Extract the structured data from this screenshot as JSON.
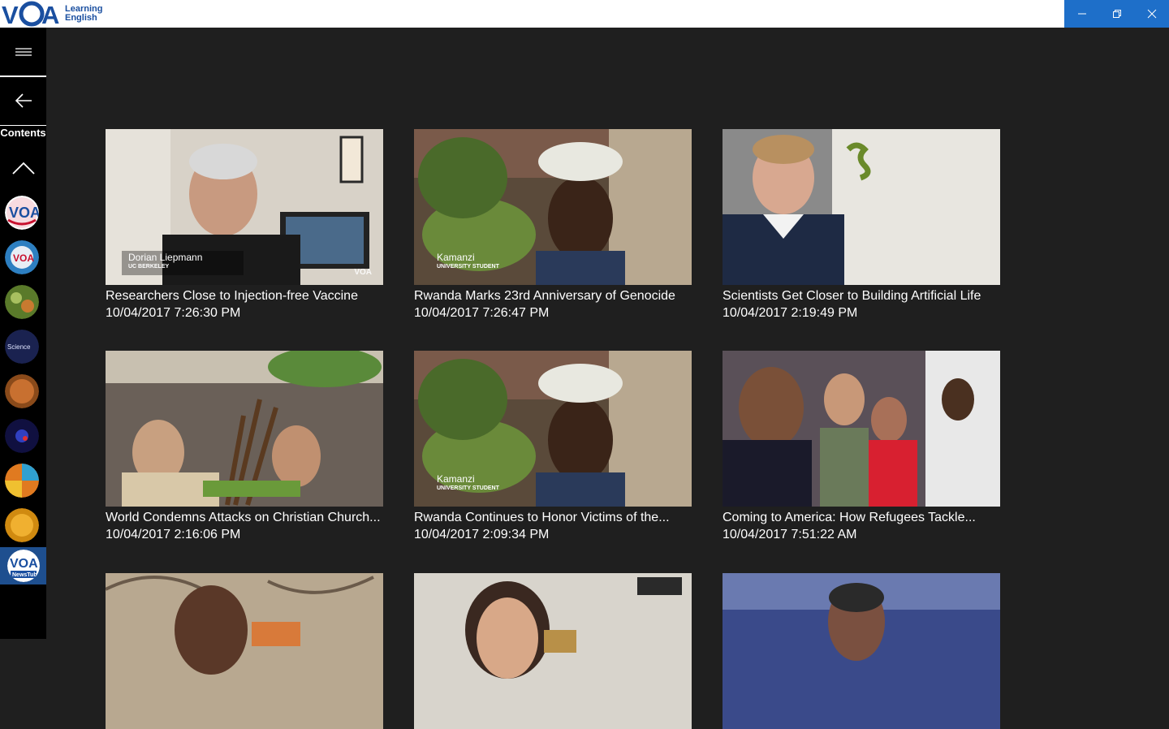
{
  "app": {
    "logo_text_line1": "Learning",
    "logo_text_line2": "English",
    "brand_color": "#1a4fa0",
    "titlebar_accent": "#1e6fc9"
  },
  "window_controls": [
    "minimize-icon",
    "restore-icon",
    "close-icon"
  ],
  "sidebar": {
    "menu_icon": "hamburger-icon",
    "back_icon": "arrow-left-icon",
    "contents_label": "Contents",
    "collapse_icon": "chevron-up-icon",
    "channels": [
      {
        "name": "channel-voa",
        "color": "#c8102e",
        "selected": false
      },
      {
        "name": "channel-voa-globe",
        "color": "#2d7fc1",
        "selected": false
      },
      {
        "name": "channel-nature",
        "color": "#5a7a2a",
        "selected": false
      },
      {
        "name": "channel-science",
        "color": "#1a2250",
        "selected": false
      },
      {
        "name": "channel-planet",
        "color": "#8a4a1a",
        "selected": false
      },
      {
        "name": "channel-space",
        "color": "#1a1a6a",
        "selected": false
      },
      {
        "name": "channel-colorful",
        "color": "#e07a20",
        "selected": false
      },
      {
        "name": "channel-orange",
        "color": "#d08a10",
        "selected": false
      },
      {
        "name": "channel-newstube",
        "color": "#1e4f8f",
        "selected": true
      }
    ]
  },
  "articles": [
    {
      "title": "Researchers Close to Injection-free Vaccine",
      "date": "10/04/2017 7:26:30 PM",
      "caption_name": "Dorian Liepmann",
      "caption_sub": "UC BERKELEY",
      "thumb": "#5a4a3e"
    },
    {
      "title": "Rwanda Marks 23rd Anniversary of Genocide",
      "date": "10/04/2017 7:26:47 PM",
      "caption_name": "Kamanzi",
      "caption_sub": "UNIVERSITY STUDENT",
      "thumb": "#4d5a3a"
    },
    {
      "title": "Scientists Get Closer to Building Artificial Life",
      "date": "10/04/2017 2:19:49 PM",
      "caption_name": "",
      "caption_sub": "",
      "thumb": "#6a6a6e"
    },
    {
      "title": "World Condemns Attacks on Christian Church...",
      "date": "10/04/2017 2:16:06 PM",
      "caption_name": "",
      "caption_sub": "",
      "thumb": "#5a4e40"
    },
    {
      "title": "Rwanda Continues to Honor Victims of the...",
      "date": "10/04/2017 2:09:34 PM",
      "caption_name": "Kamanzi",
      "caption_sub": "UNIVERSITY STUDENT",
      "thumb": "#4d5a3a"
    },
    {
      "title": "Coming to America: How Refugees Tackle...",
      "date": "10/04/2017 7:51:22 AM",
      "caption_name": "",
      "caption_sub": "",
      "thumb": "#4a4048"
    },
    {
      "title": "",
      "date": "",
      "caption_name": "",
      "caption_sub": "",
      "thumb": "#7a6a5a"
    },
    {
      "title": "",
      "date": "",
      "caption_name": "",
      "caption_sub": "",
      "thumb": "#8a7a6a"
    },
    {
      "title": "",
      "date": "",
      "caption_name": "",
      "caption_sub": "",
      "thumb": "#4a5a8a"
    }
  ]
}
